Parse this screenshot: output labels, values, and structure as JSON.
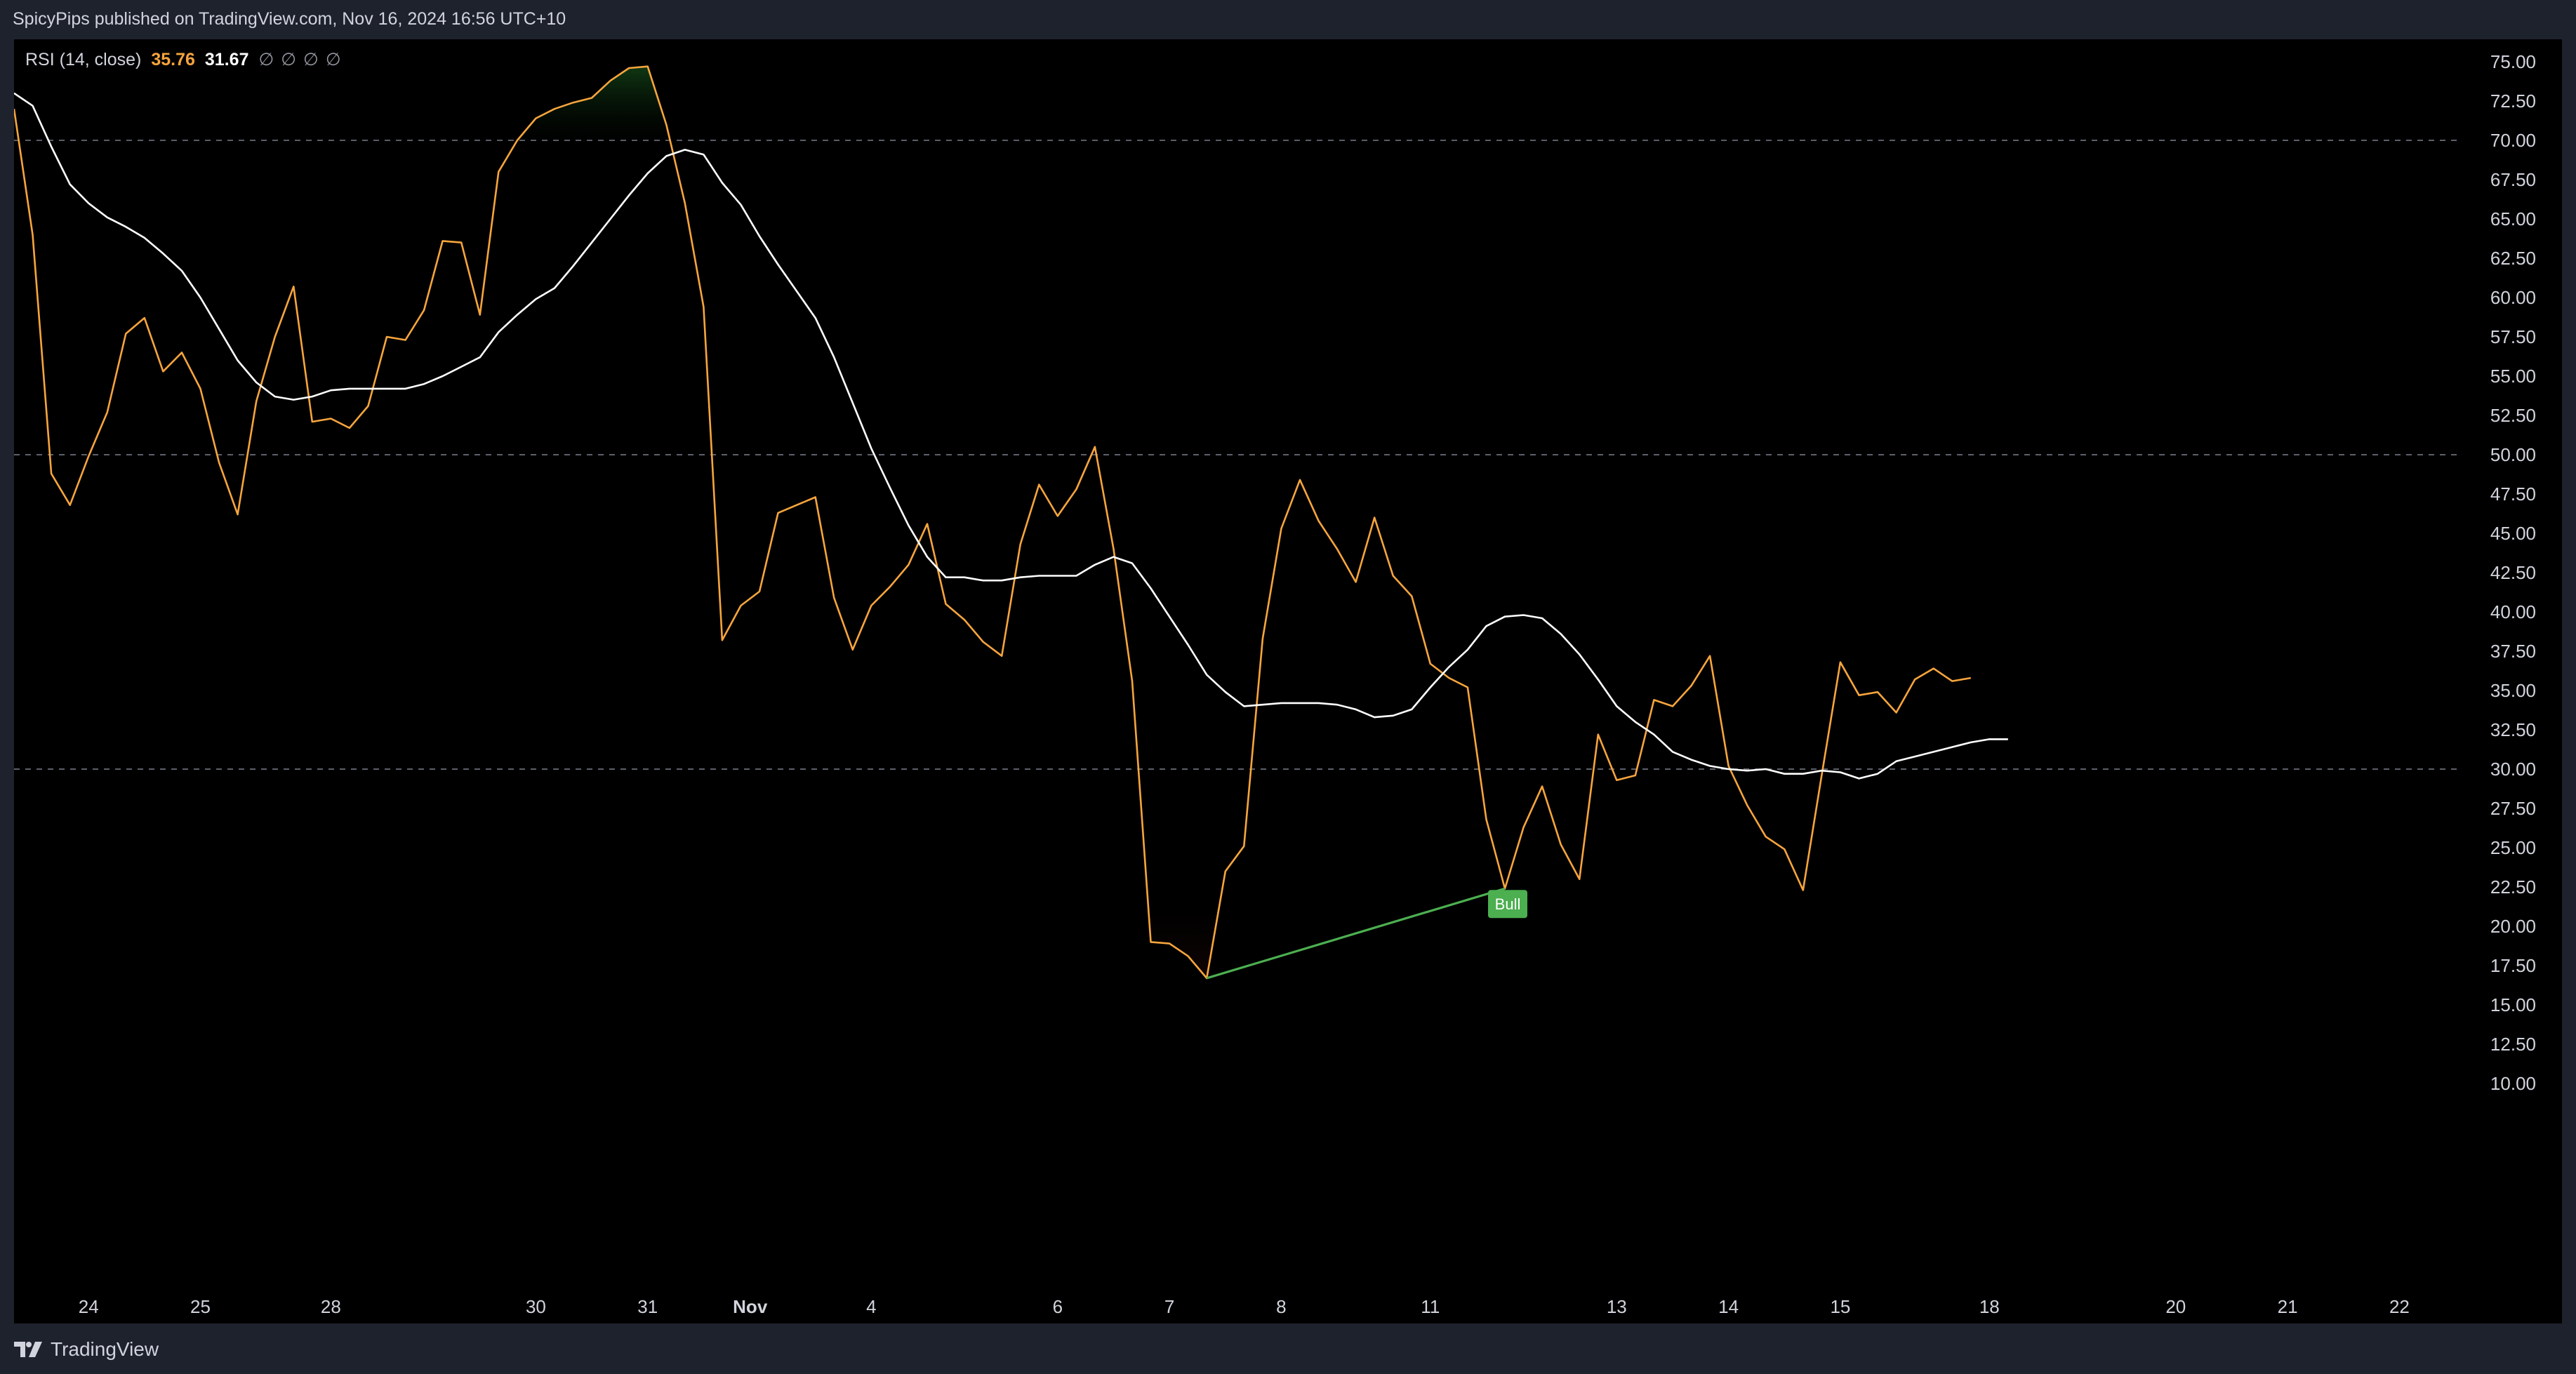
{
  "header": {
    "publisher": "SpicyPips published on TradingView.com, Nov 16, 2024 16:56 UTC+10"
  },
  "legend": {
    "indicator": "RSI (14, close)",
    "rsi_value": "35.76",
    "ma_value": "31.67",
    "na_symbol": "∅"
  },
  "footer": {
    "brand": "TradingView"
  },
  "colors": {
    "rsi_line": "#f7a53d",
    "ma_line": "#ffffff",
    "divergence": "#4caf50",
    "grid": "#5d606b",
    "axis_text": "#d1d4dc",
    "background": "#000000",
    "oversold_fill": "#a8322d",
    "overbought_fill": "#1b5e20"
  },
  "chart_data": {
    "type": "line",
    "y_ticks": [
      "75.00",
      "72.50",
      "70.00",
      "67.50",
      "65.00",
      "62.50",
      "60.00",
      "57.50",
      "55.00",
      "52.50",
      "50.00",
      "47.50",
      "45.00",
      "42.50",
      "40.00",
      "37.50",
      "35.00",
      "32.50",
      "30.00",
      "27.50",
      "25.00",
      "22.50",
      "20.00",
      "17.50",
      "15.00",
      "12.50",
      "10.00"
    ],
    "ylim": [
      8.5,
      77.2
    ],
    "bands": [
      70,
      50,
      30
    ],
    "x_ticks": [
      {
        "label": "24",
        "x": 4.0
      },
      {
        "label": "25",
        "x": 10.0
      },
      {
        "label": "28",
        "x": 17.0
      },
      {
        "label": "30",
        "x": 28.0
      },
      {
        "label": "31",
        "x": 34.0
      },
      {
        "label": "Nov",
        "x": 39.5,
        "bold": true
      },
      {
        "label": "4",
        "x": 46.0
      },
      {
        "label": "6",
        "x": 56.0
      },
      {
        "label": "7",
        "x": 62.0
      },
      {
        "label": "8",
        "x": 68.0
      },
      {
        "label": "11",
        "x": 76.0
      },
      {
        "label": "13",
        "x": 86.0
      },
      {
        "label": "14",
        "x": 92.0
      },
      {
        "label": "15",
        "x": 98.0
      },
      {
        "label": "18",
        "x": 106.0
      },
      {
        "label": "20",
        "x": 116.0
      },
      {
        "label": "21",
        "x": 122.0
      },
      {
        "label": "22",
        "x": 128.0
      }
    ],
    "xlim": [
      0.0,
      132.0
    ],
    "series": [
      {
        "values": [
          72.0,
          64.0,
          48.8,
          46.8,
          49.9,
          52.7,
          57.7,
          58.7,
          55.3,
          56.5,
          54.2,
          49.5,
          46.2,
          53.4,
          57.5,
          60.7,
          52.1,
          52.3,
          51.7,
          53.1,
          57.5,
          57.3,
          59.2,
          63.6,
          63.5,
          58.9,
          68.0,
          70.0,
          71.4,
          72.0,
          72.4,
          72.7,
          73.8,
          74.6,
          74.7,
          71.0,
          66.0,
          59.4,
          38.2,
          40.4,
          41.3,
          46.3,
          46.8,
          47.3,
          40.9,
          37.6,
          40.4,
          41.6,
          43.0,
          45.6,
          40.5,
          39.5,
          38.1,
          37.2,
          44.3,
          48.1,
          46.1,
          47.8,
          50.5,
          44.0,
          35.6,
          19.0,
          18.9,
          18.1,
          16.7,
          23.5,
          25.1,
          38.3,
          45.3,
          48.4,
          45.8,
          44.0,
          41.9,
          46.0,
          42.3,
          41.0,
          36.7,
          35.8,
          35.2,
          26.8,
          22.4,
          26.3,
          28.9,
          25.2,
          23.0,
          32.2,
          29.3,
          29.6,
          34.4,
          34.0,
          35.3,
          37.2,
          30.2,
          27.7,
          25.7,
          24.9,
          22.3,
          29.6,
          36.8,
          34.7,
          34.9,
          33.6,
          35.7,
          36.4,
          35.6,
          35.8
        ]
      },
      {
        "values": [
          73.0,
          72.2,
          69.6,
          67.2,
          66.0,
          65.1,
          64.5,
          63.8,
          62.8,
          61.7,
          60.0,
          58.0,
          56.0,
          54.6,
          53.7,
          53.5,
          53.7,
          54.1,
          54.2,
          54.2,
          54.2,
          54.2,
          54.5,
          55.0,
          55.6,
          56.2,
          57.8,
          58.9,
          59.9,
          60.6,
          62.0,
          63.5,
          65.0,
          66.5,
          67.9,
          69.0,
          69.4,
          69.1,
          67.3,
          65.9,
          63.9,
          62.1,
          60.4,
          58.7,
          56.2,
          53.3,
          50.4,
          47.9,
          45.5,
          43.5,
          42.2,
          42.2,
          42.0,
          42.0,
          42.2,
          42.3,
          42.3,
          42.3,
          43.0,
          43.5,
          43.1,
          41.5,
          39.7,
          37.9,
          36.0,
          34.9,
          34.0,
          34.1,
          34.2,
          34.2,
          34.2,
          34.1,
          33.8,
          33.3,
          33.4,
          33.8,
          35.2,
          36.5,
          37.6,
          39.1,
          39.7,
          39.8,
          39.6,
          38.6,
          37.3,
          35.7,
          34.0,
          33.0,
          32.2,
          31.1,
          30.6,
          30.2,
          30.0,
          29.9,
          30.0,
          29.7,
          29.7,
          29.9,
          29.8,
          29.4,
          29.7,
          30.5,
          30.8,
          31.1,
          31.4,
          31.7,
          31.9,
          31.9
        ]
      }
    ],
    "divergence": {
      "x1": 64,
      "y1": 16.7,
      "x2": 80,
      "y2": 22.4,
      "label": "Bull"
    }
  }
}
